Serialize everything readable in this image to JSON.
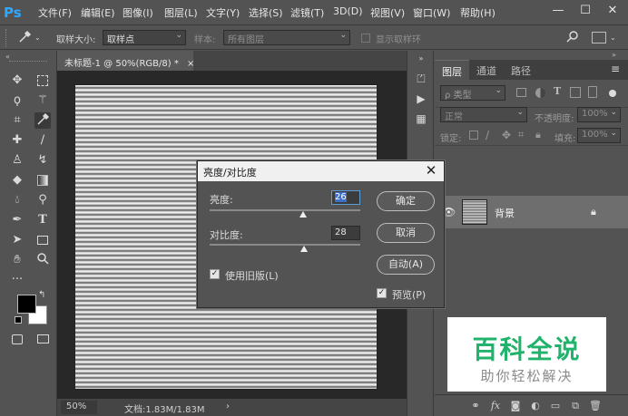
{
  "app": {
    "logo": "Ps"
  },
  "menu": [
    "文件(F)",
    "编辑(E)",
    "图像(I)",
    "图层(L)",
    "文字(Y)",
    "选择(S)",
    "滤镜(T)",
    "3D(D)",
    "视图(V)",
    "窗口(W)",
    "帮助(H)"
  ],
  "window_controls": {
    "minimize": "—",
    "maximize": "☐",
    "close": "✕"
  },
  "options": {
    "sample_size_label": "取样大小:",
    "sample_size_value": "取样点",
    "sample_label": "样本:",
    "sample_value": "所有图层",
    "show_ring_label": "显示取样环"
  },
  "document": {
    "tab_title": "未标题-1 @ 50%(RGB/8) *",
    "tab_close": "×",
    "zoom": "50%",
    "doc_info": "文档:1.83M/1.83M",
    "status_arrow": "›"
  },
  "layers_panel": {
    "tabs": [
      "图层",
      "通道",
      "路径"
    ],
    "kind_label": "ρ 类型",
    "blend_mode": "正常",
    "opacity_label": "不透明度:",
    "opacity_value": "100%",
    "lock_label": "锁定:",
    "fill_label": "填充:",
    "fill_value": "100%",
    "layer_name": "背景"
  },
  "dialog": {
    "title": "亮度/对比度",
    "close": "✕",
    "brightness_label": "亮度:",
    "brightness_value": "26",
    "contrast_label": "对比度:",
    "contrast_value": "28",
    "legacy_label": "使用旧版(L)",
    "legacy_checked": true,
    "ok": "确定",
    "cancel": "取消",
    "auto": "自动(A)",
    "preview_label": "预览(P)",
    "preview_checked": true
  },
  "watermark": {
    "main": "百科全说",
    "sub": "助你轻松解决"
  },
  "colors": {
    "accent": "#31a8ff",
    "watermark_green": "#21b36b",
    "ui_bg": "#535353"
  }
}
